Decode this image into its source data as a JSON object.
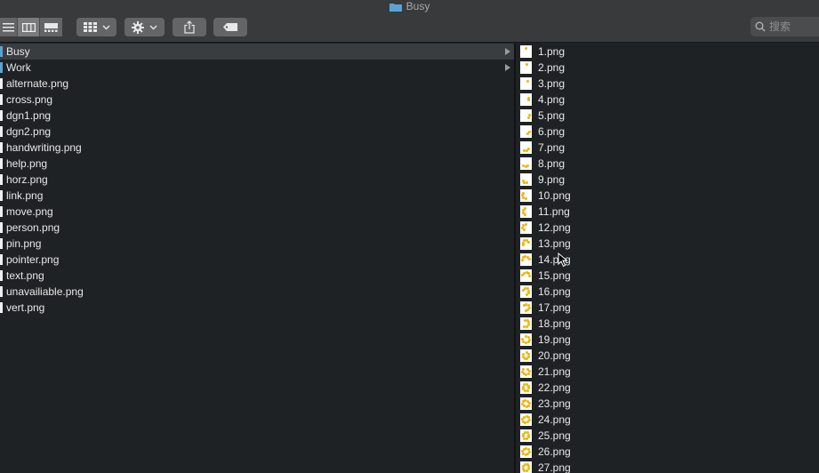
{
  "window": {
    "title": "Busy"
  },
  "toolbar": {
    "view_buttons": [
      {
        "icon": "list-view-icon",
        "active": false
      },
      {
        "icon": "column-view-icon",
        "active": true
      },
      {
        "icon": "gallery-view-icon",
        "active": false
      }
    ],
    "group_icon": "grid-group-icon",
    "action_icon": "gear-icon",
    "share_icon": "share-icon",
    "tag_icon": "tag-icon",
    "search_placeholder": "搜索"
  },
  "left_column": {
    "items": [
      {
        "label": "Busy",
        "type": "folder",
        "selected": true
      },
      {
        "label": "Work",
        "type": "folder",
        "selected": false
      },
      {
        "label": "alternate.png",
        "type": "file"
      },
      {
        "label": "cross.png",
        "type": "file"
      },
      {
        "label": "dgn1.png",
        "type": "file"
      },
      {
        "label": "dgn2.png",
        "type": "file"
      },
      {
        "label": "handwriting.png",
        "type": "file"
      },
      {
        "label": "help.png",
        "type": "file"
      },
      {
        "label": "horz.png",
        "type": "file"
      },
      {
        "label": "link.png",
        "type": "file"
      },
      {
        "label": "move.png",
        "type": "file"
      },
      {
        "label": "person.png",
        "type": "file"
      },
      {
        "label": "pin.png",
        "type": "file"
      },
      {
        "label": "pointer.png",
        "type": "file"
      },
      {
        "label": "text.png",
        "type": "file"
      },
      {
        "label": "unavailiable.png",
        "type": "file"
      },
      {
        "label": "vert.png",
        "type": "file"
      }
    ]
  },
  "right_column": {
    "items": [
      "1.png",
      "2.png",
      "3.png",
      "4.png",
      "5.png",
      "6.png",
      "7.png",
      "8.png",
      "9.png",
      "10.png",
      "11.png",
      "12.png",
      "13.png",
      "14.png",
      "15.png",
      "16.png",
      "17.png",
      "18.png",
      "19.png",
      "20.png",
      "21.png",
      "22.png",
      "23.png",
      "24.png",
      "25.png",
      "26.png",
      "27.png"
    ]
  },
  "colors": {
    "accent_folder": "#5aa3d8",
    "thumbnail_spinner": "#f4b400"
  }
}
